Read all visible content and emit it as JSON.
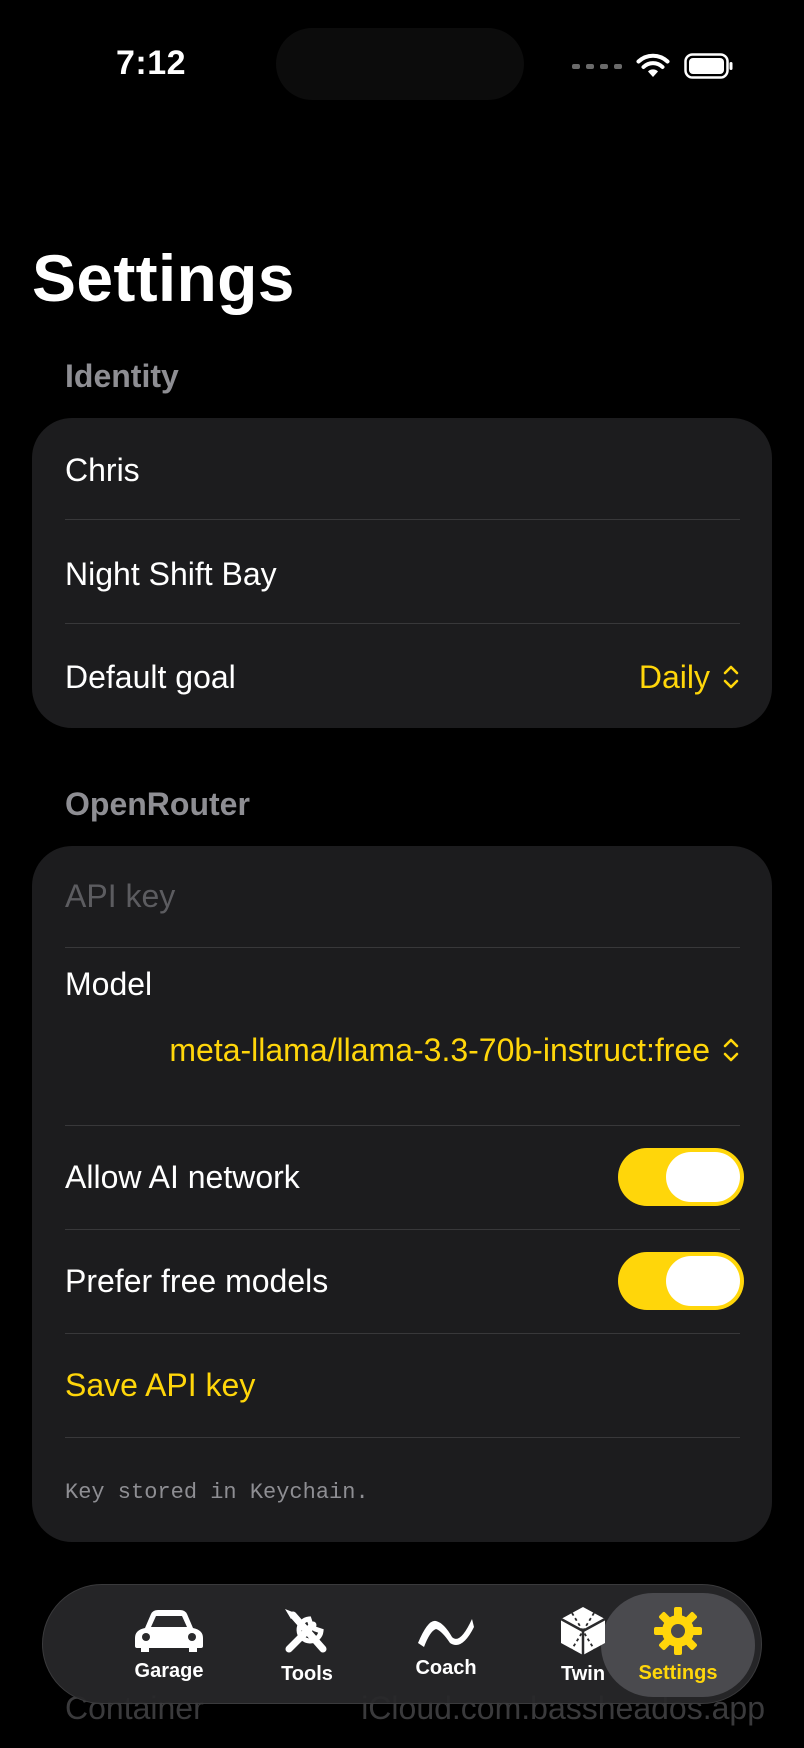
{
  "status": {
    "time": "7:12"
  },
  "title": "Settings",
  "identity": {
    "header": "Identity",
    "name": "Chris",
    "bay": "Night Shift Bay",
    "goal_label": "Default goal",
    "goal_value": "Daily"
  },
  "openrouter": {
    "header": "OpenRouter",
    "api_key_placeholder": "API key",
    "model_label": "Model",
    "model_value": "meta-llama/llama-3.3-70b-instruct:free",
    "allow_network_label": "Allow AI network",
    "allow_network_on": true,
    "prefer_free_label": "Prefer free models",
    "prefer_free_on": true,
    "save_label": "Save API key",
    "footnote": "Key stored in Keychain."
  },
  "behind": {
    "container_label": "Container",
    "container_value": "iCloud.com.bassheados.app"
  },
  "tabs": [
    {
      "label": "Garage",
      "icon": "car-icon"
    },
    {
      "label": "Tools",
      "icon": "tools-icon"
    },
    {
      "label": "Coach",
      "icon": "chart-line-icon"
    },
    {
      "label": "Twin",
      "icon": "cube-icon"
    },
    {
      "label": "Settings",
      "icon": "gear-icon",
      "active": true
    }
  ],
  "colors": {
    "accent": "#ffd60a",
    "card": "#1c1c1e",
    "background": "#000000"
  }
}
